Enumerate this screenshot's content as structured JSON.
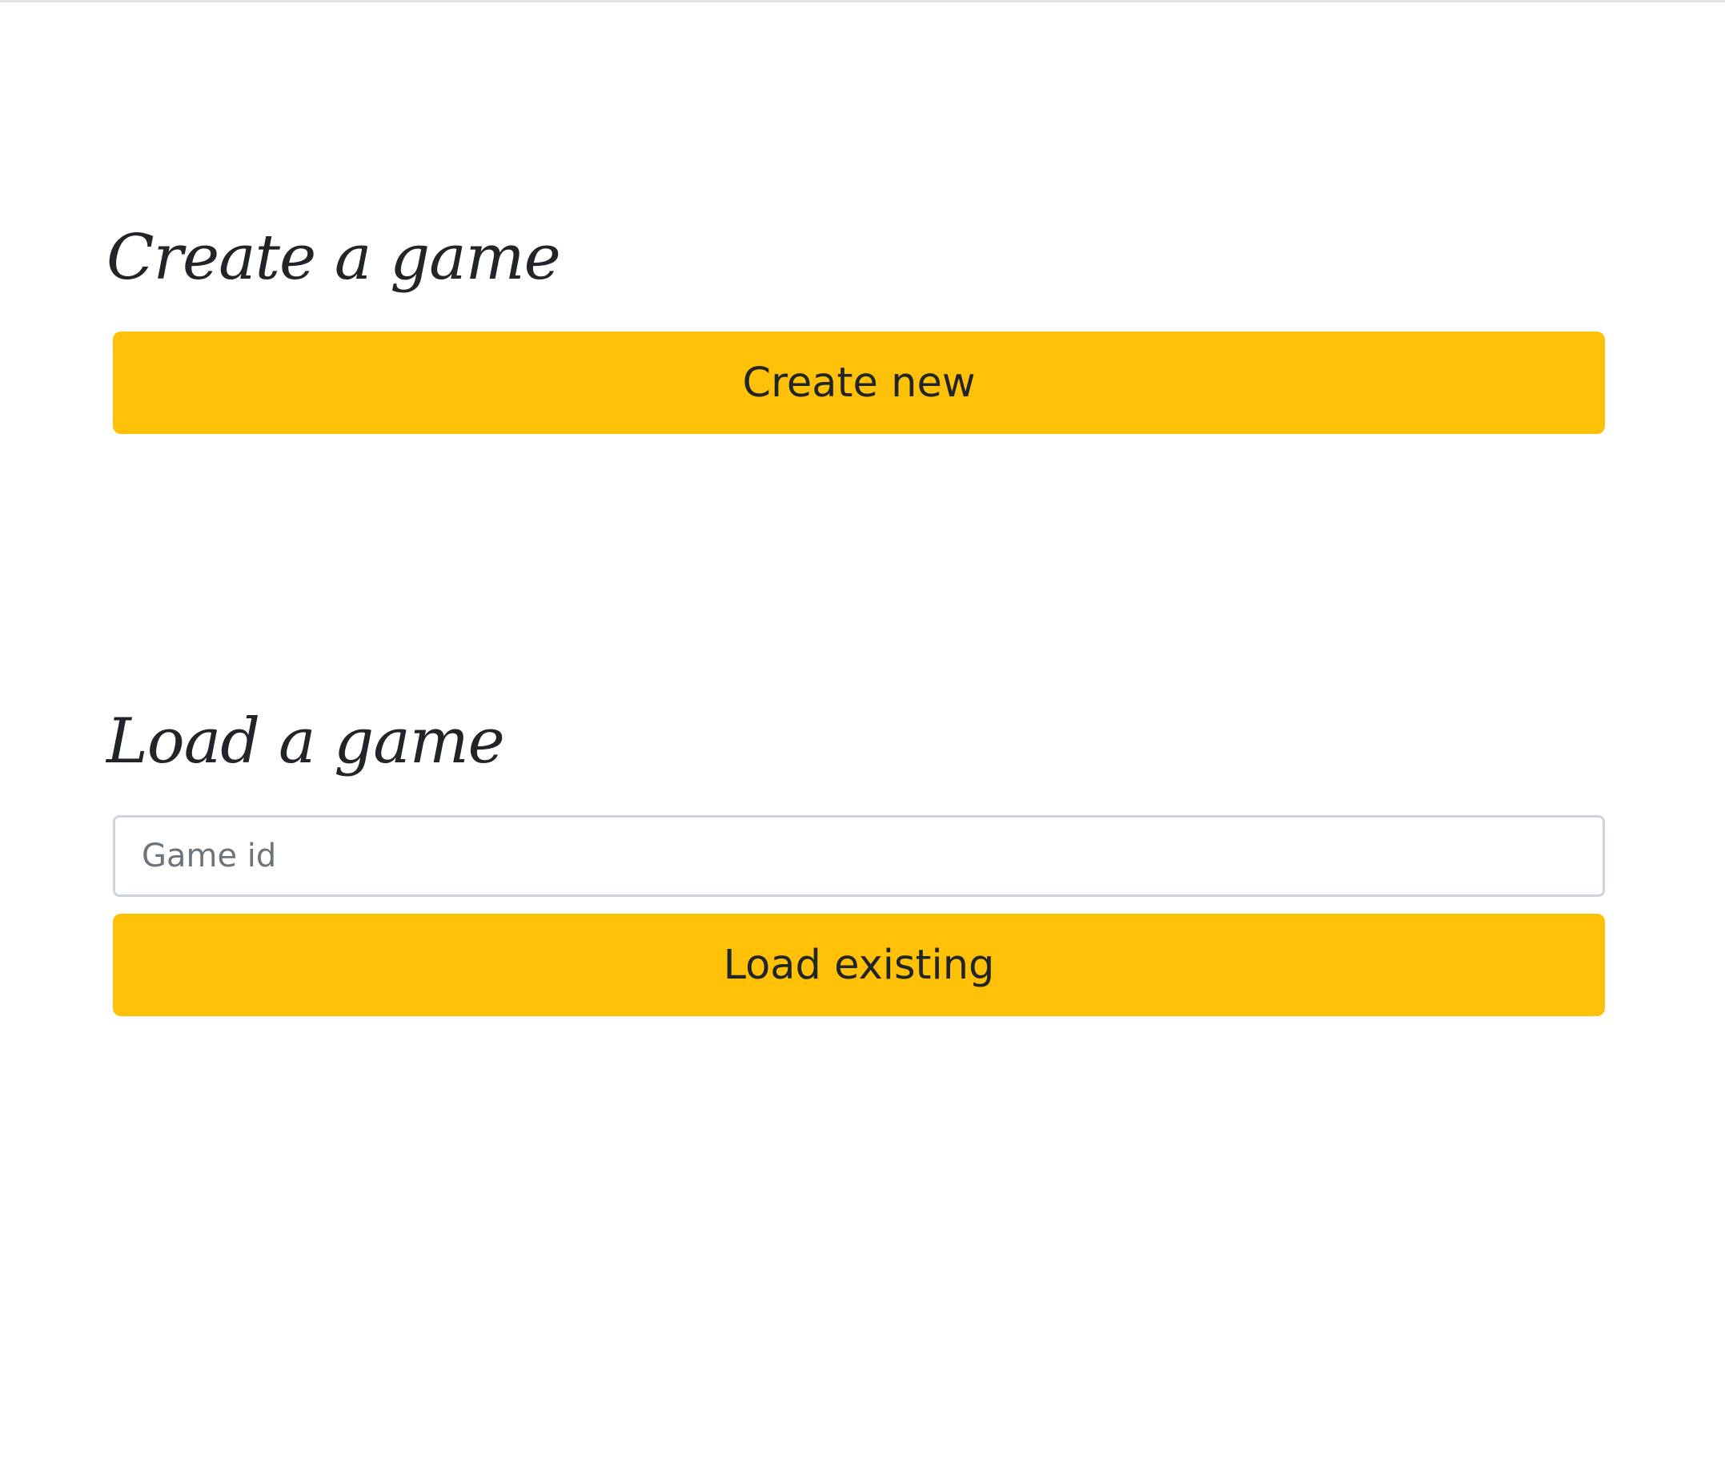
{
  "create_section": {
    "heading": "Create a game",
    "button_label": "Create new"
  },
  "load_section": {
    "heading": "Load a game",
    "input_placeholder": "Game id",
    "input_value": "",
    "button_label": "Load existing"
  },
  "colors": {
    "button_background": "#ffc107",
    "text": "#212529",
    "input_border": "#ced4da",
    "placeholder": "#6c757d",
    "page_background": "#ffffff"
  }
}
